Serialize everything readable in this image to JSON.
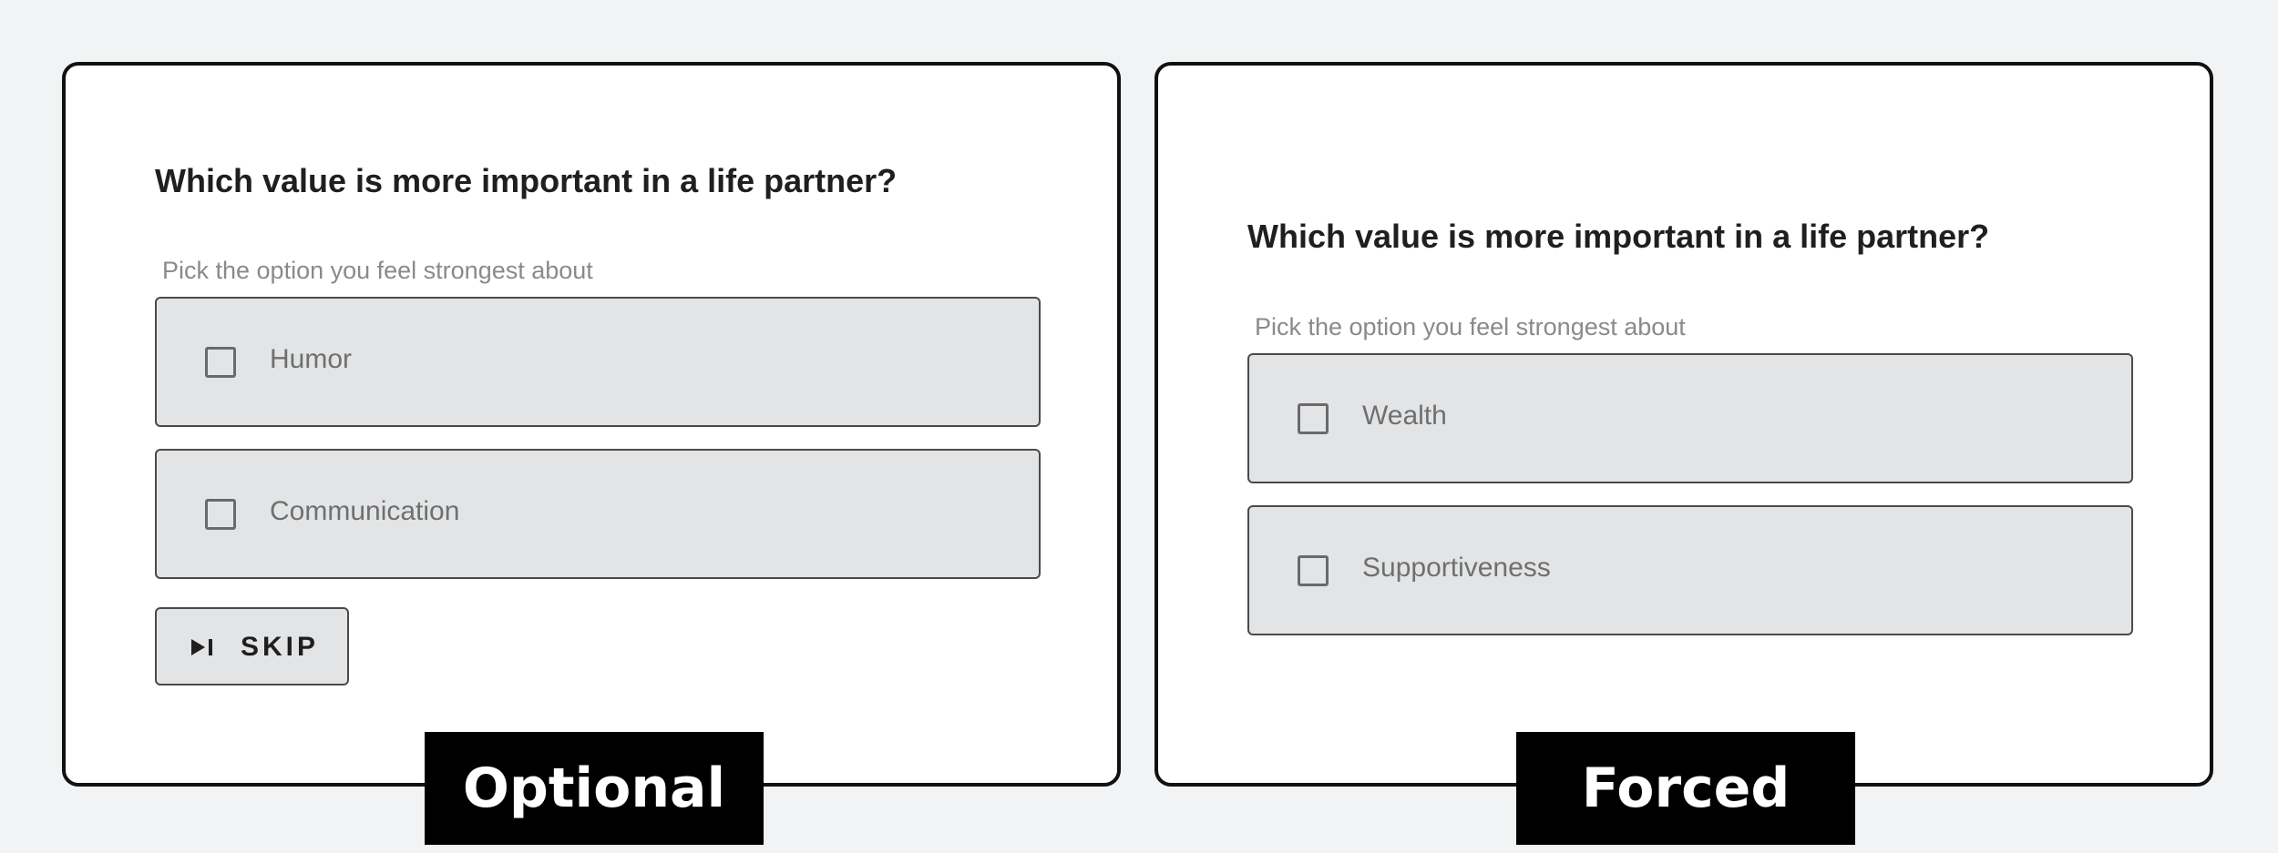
{
  "panels": {
    "optional": {
      "question": "Which value is more important in a life partner?",
      "hint": "Pick the option you feel strongest about",
      "options": [
        {
          "label": "Humor",
          "checked": false
        },
        {
          "label": "Communication",
          "checked": false
        }
      ],
      "skip": {
        "label": "SKIP",
        "icon": "skip-next-icon"
      },
      "tag": "Optional"
    },
    "forced": {
      "question": "Which value is more important in a life partner?",
      "hint": "Pick the option you feel strongest about",
      "options": [
        {
          "label": "Wealth",
          "checked": false
        },
        {
          "label": "Supportiveness",
          "checked": false
        }
      ],
      "tag": "Forced"
    }
  },
  "colors": {
    "background": "#f2f3f5",
    "panel": "#ffffff",
    "option_fill": "#e3e4e6",
    "border": "#111111",
    "tag_fill": "#000000",
    "tag_text": "#ffffff"
  }
}
